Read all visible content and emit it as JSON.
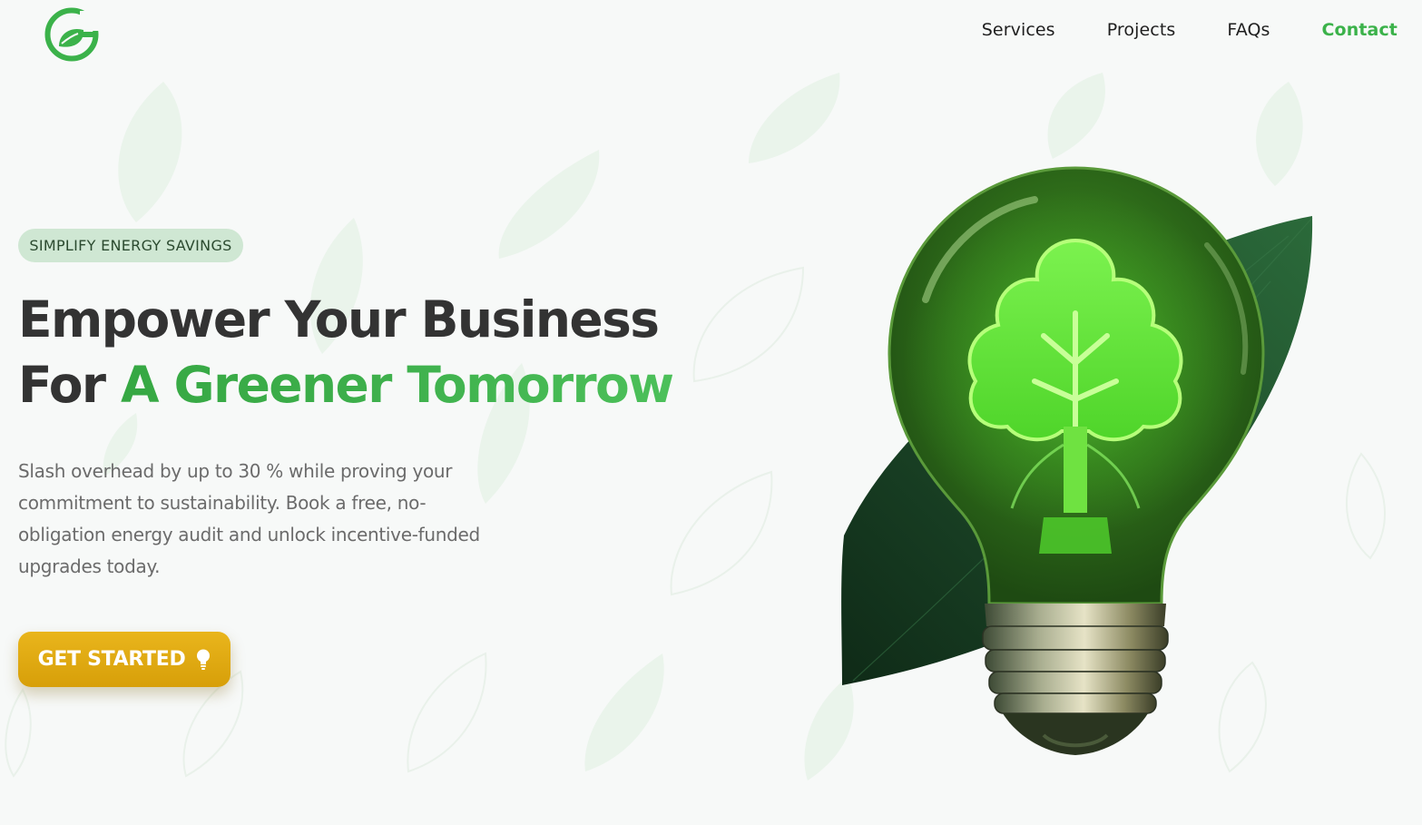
{
  "nav": {
    "items": [
      {
        "label": "Services"
      },
      {
        "label": "Projects"
      },
      {
        "label": "FAQs"
      },
      {
        "label": "Contact",
        "active": true
      }
    ]
  },
  "hero": {
    "badge": "SIMPLIFY ENERGY SAVINGS",
    "title_line1": "Empower Your Business",
    "title_line2_prefix": "For ",
    "title_line2_highlight": "A Greener Tomorrow",
    "description": "Slash overhead by up to 30 % while proving your commitment to sustainability. Book a free, no-obligation energy audit and unlock incentive-funded upgrades today.",
    "cta_label": "GET STARTED",
    "cta_icon": "lightbulb-icon"
  },
  "colors": {
    "brand_green": "#3bb24a",
    "badge_bg": "#cfe7d3",
    "cta_gold": "#e0aa12",
    "text_dark": "#333333",
    "text_body": "#6b6b6b"
  }
}
